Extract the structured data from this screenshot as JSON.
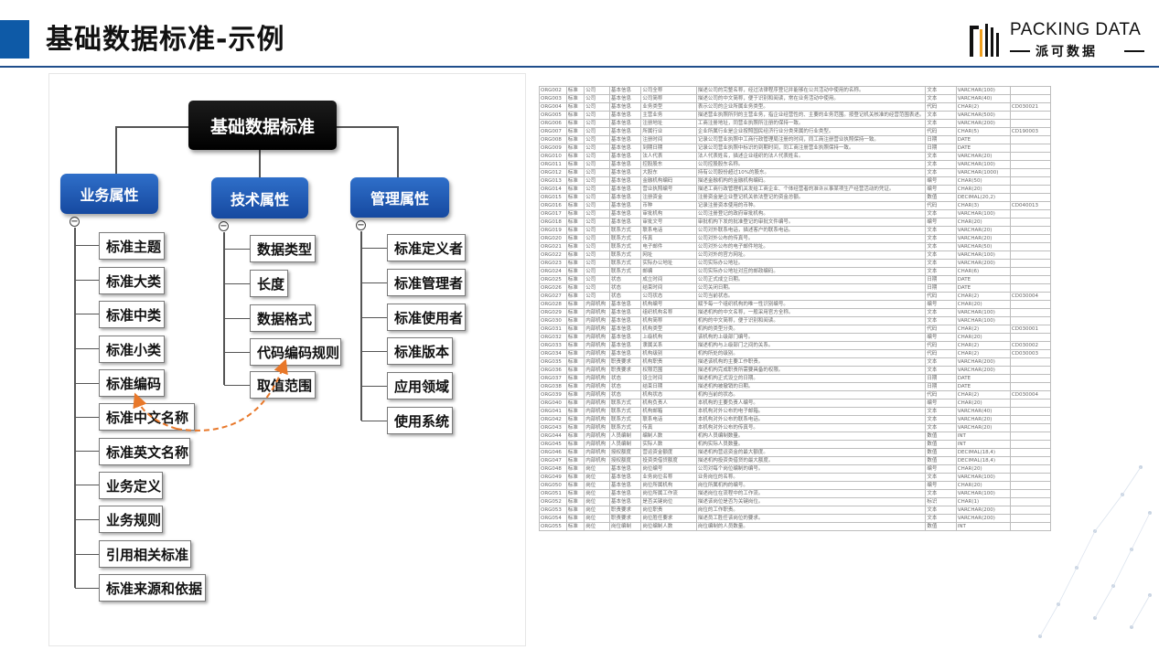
{
  "header": {
    "title": "基础数据标准-示例",
    "logo_en": "PACKING DATA",
    "logo_cn": "派可数据",
    "accent_color": "#0e5aa7"
  },
  "tree": {
    "root": "基础数据标准",
    "categories": [
      {
        "label": "业务属性",
        "items": [
          "标准主题",
          "标准大类",
          "标准中类",
          "标准小类",
          "标准编码",
          "标准中文名称",
          "标准英文名称",
          "业务定义",
          "业务规则",
          "引用相关标准",
          "标准来源和依据"
        ]
      },
      {
        "label": "技术属性",
        "items": [
          "数据类型",
          "长度",
          "数据格式",
          "代码编码规则",
          "取值范围"
        ]
      },
      {
        "label": "管理属性",
        "items": [
          "标准定义者",
          "标准管理者",
          "标准使用者",
          "标准版本",
          "应用领域",
          "使用系统"
        ]
      }
    ],
    "link_color": "#e8782a"
  },
  "spec_table": {
    "rows": [
      [
        "ORG002",
        "标准",
        "公司",
        "基本信息",
        "公司全称",
        "描述公司的完整名称，经过法律程序登记并能够在公共活动中使用的名称。",
        "文本",
        "VARCHAR(100)",
        ""
      ],
      [
        "ORG003",
        "标准",
        "公司",
        "基本信息",
        "公司简称",
        "描述公司的中文简称，便于识别和阅读，常在业务活动中使用。",
        "文本",
        "VARCHAR(40)",
        ""
      ],
      [
        "ORG004",
        "标准",
        "公司",
        "基本信息",
        "业务类型",
        "表示公司的企业所属业务类型。",
        "代码",
        "CHAR(2)",
        "CD030021"
      ],
      [
        "ORG005",
        "标准",
        "公司",
        "基本信息",
        "主营业务",
        "描述营业执照所列的主营业务，指企业经营性的、主要的业务范围。按登记机关核准的经营范围表述。",
        "文本",
        "VARCHAR(500)",
        ""
      ],
      [
        "ORG006",
        "标准",
        "公司",
        "基本信息",
        "注册地址",
        "工商注册地址，同营业执照所注册的保持一致。",
        "文本",
        "VARCHAR(200)",
        ""
      ],
      [
        "ORG007",
        "标准",
        "公司",
        "基本信息",
        "所属行业",
        "企业所属行业是企业按照国民经济行业分类来属的行业类型。",
        "代码",
        "CHAR(5)",
        "CD190003"
      ],
      [
        "ORG008",
        "标准",
        "公司",
        "基本信息",
        "注册时间",
        "记录公司营业执照中工商行政管理局注册的时间，同工商注册营业执照保持一致。",
        "日期",
        "DATE",
        ""
      ],
      [
        "ORG009",
        "标准",
        "公司",
        "基本信息",
        "到期日期",
        "记录公司营业执照中标识的到期时间，同工商注册营业执照保持一致。",
        "日期",
        "DATE",
        ""
      ],
      [
        "ORG010",
        "标准",
        "公司",
        "基本信息",
        "法人代表",
        "法人代表姓名，描述企业组织的法人代表姓名。",
        "文本",
        "VARCHAR(20)",
        ""
      ],
      [
        "ORG011",
        "标准",
        "公司",
        "基本信息",
        "控股股东",
        "公司控股股东名称。",
        "文本",
        "VARCHAR(100)",
        ""
      ],
      [
        "ORG012",
        "标准",
        "公司",
        "基本信息",
        "大股东",
        "持有公司股份超过10%的股东。",
        "文本",
        "VARCHAR(1000)",
        ""
      ],
      [
        "ORG013",
        "标准",
        "公司",
        "基本信息",
        "金融机构编码",
        "描述金融机构的金融机构编码。",
        "编号",
        "CHAR(50)",
        ""
      ],
      [
        "ORG014",
        "标准",
        "公司",
        "基本信息",
        "营业执照编号",
        "描述工商行政管理机关发给工商企业、个体经营者的准许从事某项生产经营活动的凭证。",
        "编号",
        "CHAR(20)",
        ""
      ],
      [
        "ORG015",
        "标准",
        "公司",
        "基本信息",
        "注册资金",
        "注册资金是企业登记机关依法登记的资金总额。",
        "数值",
        "DECIMAL(20,2)",
        ""
      ],
      [
        "ORG016",
        "标准",
        "公司",
        "基本信息",
        "币种",
        "记录注册资本使用的币种。",
        "代码",
        "CHAR(3)",
        "CD040013"
      ],
      [
        "ORG017",
        "标准",
        "公司",
        "基本信息",
        "审批机构",
        "公司注册登记的政府审批机构。",
        "文本",
        "VARCHAR(100)",
        ""
      ],
      [
        "ORG018",
        "标准",
        "公司",
        "基本信息",
        "审批文号",
        "审批机构下发的批准登记的审批文件编号。",
        "编号",
        "CHAR(20)",
        ""
      ],
      [
        "ORG019",
        "标准",
        "公司",
        "联系方式",
        "联系电话",
        "公司对外联系电话，描述客户的联系电话。",
        "文本",
        "VARCHAR(20)",
        ""
      ],
      [
        "ORG020",
        "标准",
        "公司",
        "联系方式",
        "传真",
        "公司对外公布的传真号。",
        "文本",
        "VARCHAR(20)",
        ""
      ],
      [
        "ORG021",
        "标准",
        "公司",
        "联系方式",
        "电子邮件",
        "公司对外公布的电子邮件地址。",
        "文本",
        "VARCHAR(50)",
        ""
      ],
      [
        "ORG022",
        "标准",
        "公司",
        "联系方式",
        "网址",
        "公司对外的官方网址。",
        "文本",
        "VARCHAR(100)",
        ""
      ],
      [
        "ORG023",
        "标准",
        "公司",
        "联系方式",
        "实际办公地址",
        "公司实际办公地址。",
        "文本",
        "VARCHAR(200)",
        ""
      ],
      [
        "ORG024",
        "标准",
        "公司",
        "联系方式",
        "邮编",
        "公司实际办公地址对应的邮政编码。",
        "文本",
        "CHAR(6)",
        ""
      ],
      [
        "ORG025",
        "标准",
        "公司",
        "状态",
        "成立时间",
        "公司正式成立日期。",
        "日期",
        "DATE",
        ""
      ],
      [
        "ORG026",
        "标准",
        "公司",
        "状态",
        "结束时间",
        "公司关闭日期。",
        "日期",
        "DATE",
        ""
      ],
      [
        "ORG027",
        "标准",
        "公司",
        "状态",
        "公司状态",
        "公司当前状态。",
        "代码",
        "CHAR(2)",
        "CD030004"
      ],
      [
        "ORG028",
        "标准",
        "内部机构",
        "基本信息",
        "机构编号",
        "赋予每一个组织机构的唯一性识别编号。",
        "编号",
        "CHAR(20)",
        ""
      ],
      [
        "ORG029",
        "标准",
        "内部机构",
        "基本信息",
        "组织机构名称",
        "描述机构的中文名称，一般采用官方全称。",
        "文本",
        "VARCHAR(100)",
        ""
      ],
      [
        "ORG030",
        "标准",
        "内部机构",
        "基本信息",
        "机构简称",
        "机构的中文简称，便于识别和阅读。",
        "文本",
        "VARCHAR(100)",
        ""
      ],
      [
        "ORG031",
        "标准",
        "内部机构",
        "基本信息",
        "机构类型",
        "机构的类型分类。",
        "代码",
        "CHAR(2)",
        "CD030001"
      ],
      [
        "ORG032",
        "标准",
        "内部机构",
        "基本信息",
        "上级机构",
        "该机构的上级部门编号。",
        "编号",
        "CHAR(20)",
        ""
      ],
      [
        "ORG033",
        "标准",
        "内部机构",
        "基本信息",
        "隶属关系",
        "描述机构与上级部门之间的关系。",
        "代码",
        "CHAR(2)",
        "CD030002"
      ],
      [
        "ORG034",
        "标准",
        "内部机构",
        "基本信息",
        "机构级别",
        "机构所处的级别。",
        "代码",
        "CHAR(2)",
        "CD030003"
      ],
      [
        "ORG035",
        "标准",
        "内部机构",
        "职责要求",
        "机构职责",
        "描述该机构的主要工作职责。",
        "文本",
        "VARCHAR(200)",
        ""
      ],
      [
        "ORG036",
        "标准",
        "内部机构",
        "职责要求",
        "权限范围",
        "描述机构完成职责所需要具备的权限。",
        "文本",
        "VARCHAR(200)",
        ""
      ],
      [
        "ORG037",
        "标准",
        "内部机构",
        "状态",
        "设立时间",
        "描述机构正式设立的日期。",
        "日期",
        "DATE",
        ""
      ],
      [
        "ORG038",
        "标准",
        "内部机构",
        "状态",
        "结束日期",
        "描述机构被撤销的日期。",
        "日期",
        "DATE",
        ""
      ],
      [
        "ORG039",
        "标准",
        "内部机构",
        "状态",
        "机构状态",
        "机构当前的状态。",
        "代码",
        "CHAR(2)",
        "CD030004"
      ],
      [
        "ORG040",
        "标准",
        "内部机构",
        "联系方式",
        "机构负责人",
        "本机构的主要负责人编号。",
        "编号",
        "CHAR(20)",
        ""
      ],
      [
        "ORG041",
        "标准",
        "内部机构",
        "联系方式",
        "机构邮箱",
        "本机构对外公布的电子邮箱。",
        "文本",
        "VARCHAR(40)",
        ""
      ],
      [
        "ORG042",
        "标准",
        "内部机构",
        "联系方式",
        "联系电话",
        "本机构对外公布的联系电话。",
        "文本",
        "VARCHAR(20)",
        ""
      ],
      [
        "ORG043",
        "标准",
        "内部机构",
        "联系方式",
        "传真",
        "本机构对外公布的传真号。",
        "文本",
        "VARCHAR(20)",
        ""
      ],
      [
        "ORG044",
        "标准",
        "内部机构",
        "人员编制",
        "编制人数",
        "机构人员编制数量。",
        "数值",
        "INT",
        ""
      ],
      [
        "ORG045",
        "标准",
        "内部机构",
        "人员编制",
        "实际人数",
        "机构实际人员数量。",
        "数值",
        "INT",
        ""
      ],
      [
        "ORG046",
        "标准",
        "内部机构",
        "授权额度",
        "营运资金额度",
        "描述机构营运资金的最大额度。",
        "数值",
        "DECIMAL(18,4)",
        ""
      ],
      [
        "ORG047",
        "标准",
        "内部机构",
        "授权额度",
        "投资类借贷额度",
        "描述机构投资类借贷的最大额度。",
        "数值",
        "DECIMAL(18,4)",
        ""
      ],
      [
        "ORG048",
        "标准",
        "岗位",
        "基本信息",
        "岗位编号",
        "公司对每个岗位编制的编号。",
        "编号",
        "CHAR(20)",
        ""
      ],
      [
        "ORG049",
        "标准",
        "岗位",
        "基本信息",
        "业务岗位名称",
        "业务岗位的名称。",
        "文本",
        "VARCHAR(100)",
        ""
      ],
      [
        "ORG050",
        "标准",
        "岗位",
        "基本信息",
        "岗位所属机构",
        "岗位所属机构的编号。",
        "编号",
        "CHAR(20)",
        ""
      ],
      [
        "ORG051",
        "标准",
        "岗位",
        "基本信息",
        "岗位所属工作流",
        "描述岗位在流程中的工作流。",
        "文本",
        "VARCHAR(100)",
        ""
      ],
      [
        "ORG052",
        "标准",
        "岗位",
        "基本信息",
        "是否关键岗位",
        "描述该岗位是否为关键岗位。",
        "标识",
        "CHAR(1)",
        ""
      ],
      [
        "ORG053",
        "标准",
        "岗位",
        "职责要求",
        "岗位职责",
        "岗位的工作职责。",
        "文本",
        "VARCHAR(200)",
        ""
      ],
      [
        "ORG054",
        "标准",
        "岗位",
        "职责要求",
        "岗位胜任要求",
        "描述员工胜任该岗位的要求。",
        "文本",
        "VARCHAR(200)",
        ""
      ],
      [
        "ORG055",
        "标准",
        "岗位",
        "岗位编制",
        "岗位编制人数",
        "岗位编制的人员数量。",
        "数值",
        "INT",
        ""
      ]
    ]
  }
}
